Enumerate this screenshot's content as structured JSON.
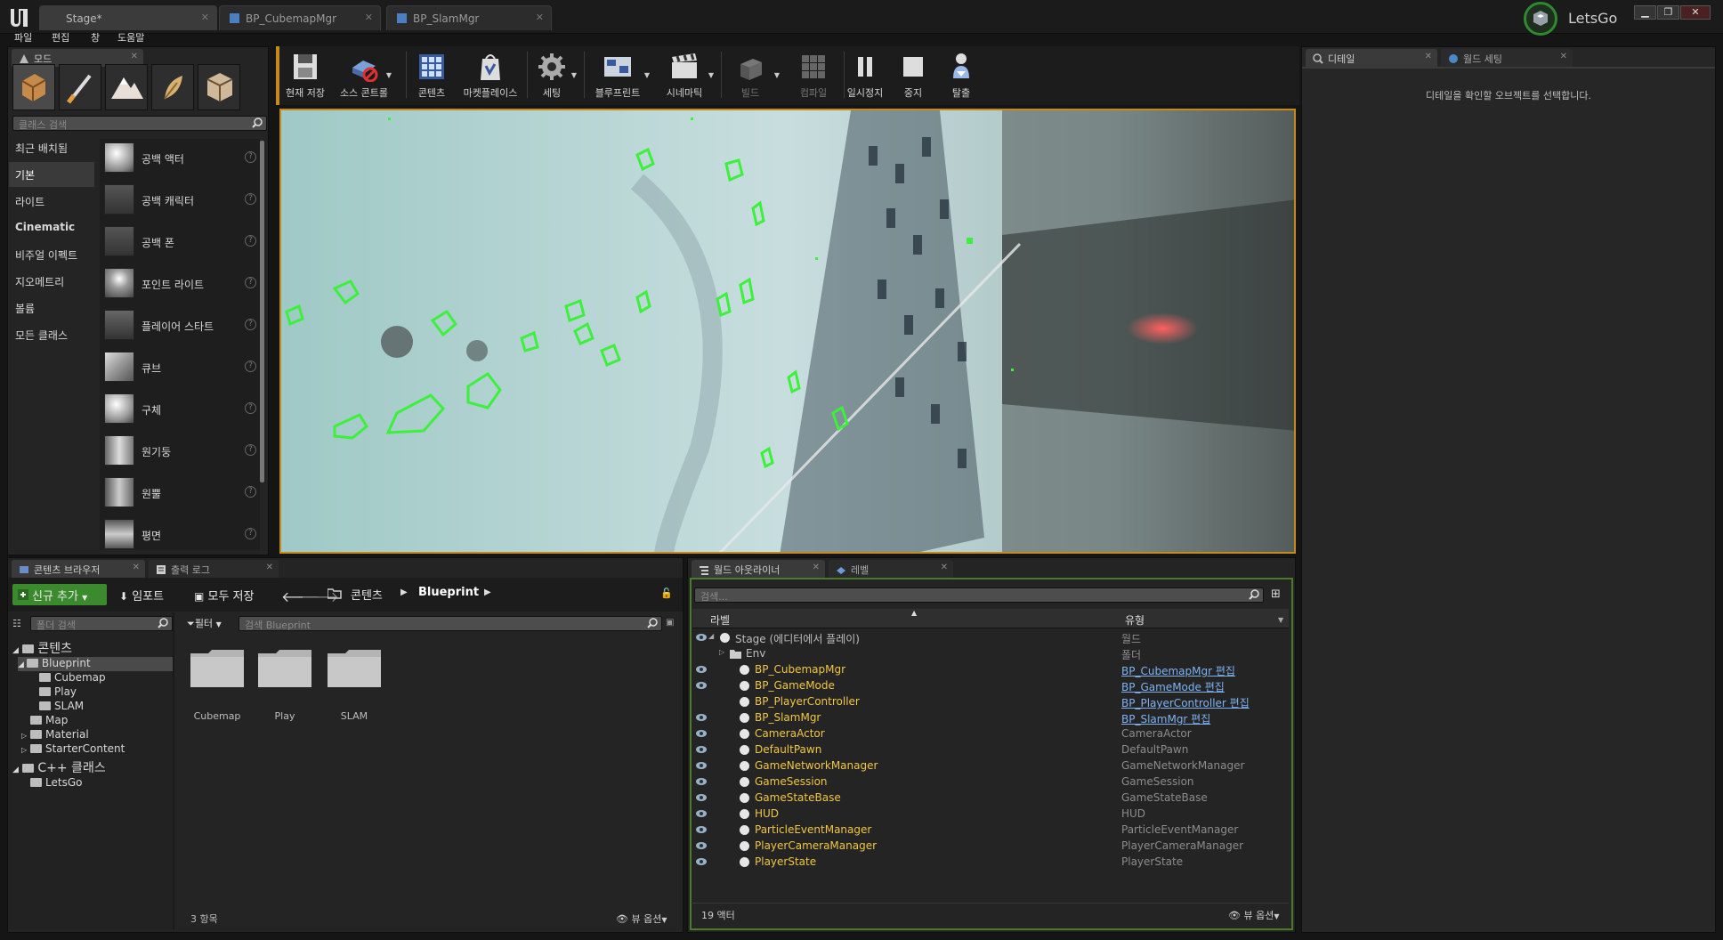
{
  "window": {
    "tabs": [
      {
        "label": "Stage*"
      },
      {
        "label": "BP_CubemapMgr"
      },
      {
        "label": "BP_SlamMgr"
      }
    ],
    "project_name": "LetsGo",
    "menu": [
      "파일",
      "편집",
      "창",
      "도움말"
    ],
    "controls": {
      "minimize": "▁",
      "restore": "❐",
      "close": "✕"
    }
  },
  "modes": {
    "tab_label": "모드",
    "search_placeholder": "클래스 검색",
    "categories": [
      "최근 배치됨",
      "기본",
      "라이트",
      "Cinematic",
      "비주얼 이펙트",
      "지오메트리",
      "볼륨",
      "모든 클래스"
    ],
    "active_category": "기본",
    "items": [
      "공백 액터",
      "공백 캐릭터",
      "공백 폰",
      "포인트 라이트",
      "플레이어 스타트",
      "큐브",
      "구체",
      "원기둥",
      "원뿔",
      "평면"
    ]
  },
  "toolbar": {
    "buttons": [
      "현재 저장",
      "소스 콘트롤",
      "콘텐츠",
      "마켓플레이스",
      "세팅",
      "블루프린트",
      "시네마틱",
      "빌드",
      "컴파일",
      "일시정지",
      "중지",
      "탈출"
    ]
  },
  "details": {
    "tab_label": "디테일",
    "world_tab_label": "월드 세팅",
    "empty_message": "디테일을 확인할 오브젝트를 선택합니다."
  },
  "content_browser": {
    "tab_label": "콘텐츠 브라우저",
    "log_tab_label": "출력 로그",
    "add_new": "신규 추가",
    "import": "임포트",
    "save_all": "모두 저장",
    "path": [
      "콘텐츠",
      "Blueprint"
    ],
    "folder_search_placeholder": "폴더 검색",
    "filter_label": "필터",
    "asset_search_placeholder": "검색 Blueprint",
    "tree": [
      {
        "label": "콘텐츠",
        "level": 0
      },
      {
        "label": "Blueprint",
        "level": 1
      },
      {
        "label": "Cubemap",
        "level": 2
      },
      {
        "label": "Play",
        "level": 2
      },
      {
        "label": "SLAM",
        "level": 2
      },
      {
        "label": "Map",
        "level": 1
      },
      {
        "label": "Material",
        "level": 1
      },
      {
        "label": "StarterContent",
        "level": 1
      },
      {
        "label": "C++ 클래스",
        "level": 0
      },
      {
        "label": "LetsGo",
        "level": 1
      }
    ],
    "folders": [
      "Cubemap",
      "Play",
      "SLAM"
    ],
    "item_count": "3 항목",
    "view_options": "뷰 옵션"
  },
  "outliner": {
    "tab_label": "월드 아웃라이너",
    "levels_tab_label": "레벨",
    "search_placeholder": "검색...",
    "col_label": "라벨",
    "col_type": "유형",
    "rows": [
      {
        "name": "Stage (에디터에서 플레이)",
        "type": "월드",
        "link": false
      },
      {
        "name": "Env",
        "type": "폴더",
        "link": false
      },
      {
        "name": "BP_CubemapMgr",
        "type": "BP_CubemapMgr 편집",
        "link": true
      },
      {
        "name": "BP_GameMode",
        "type": "BP_GameMode 편집",
        "link": true
      },
      {
        "name": "BP_PlayerController",
        "type": "BP_PlayerController 편집",
        "link": true
      },
      {
        "name": "BP_SlamMgr",
        "type": "BP_SlamMgr 편집",
        "link": true
      },
      {
        "name": "CameraActor",
        "type": "CameraActor",
        "link": false
      },
      {
        "name": "DefaultPawn",
        "type": "DefaultPawn",
        "link": false
      },
      {
        "name": "GameNetworkManager",
        "type": "GameNetworkManager",
        "link": false
      },
      {
        "name": "GameSession",
        "type": "GameSession",
        "link": false
      },
      {
        "name": "GameStateBase",
        "type": "GameStateBase",
        "link": false
      },
      {
        "name": "HUD",
        "type": "HUD",
        "link": false
      },
      {
        "name": "ParticleEventManager",
        "type": "ParticleEventManager",
        "link": false
      },
      {
        "name": "PlayerCameraManager",
        "type": "PlayerCameraManager",
        "link": false
      },
      {
        "name": "PlayerState",
        "type": "PlayerState",
        "link": false
      }
    ],
    "actor_count": "19 액터",
    "view_options": "뷰 옵션"
  },
  "colors": {
    "accent_green": "#3fa63f",
    "viewport_border": "#c58a1a",
    "actor_name": "#f2c640",
    "link": "#7fb2f0"
  }
}
